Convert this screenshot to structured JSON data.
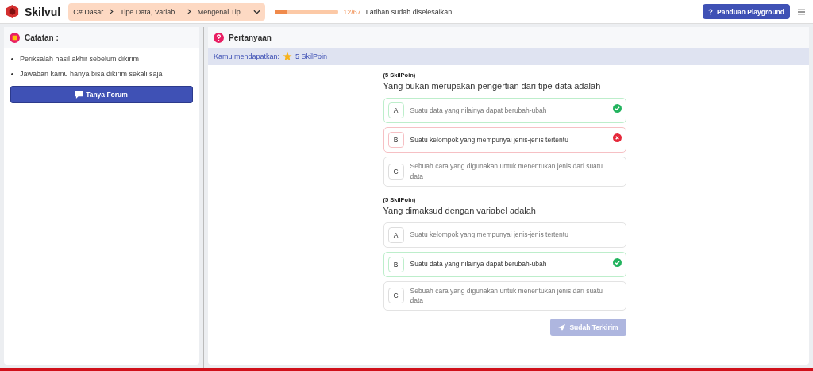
{
  "brand": "Skilvul",
  "breadcrumb": [
    "C# Dasar",
    "Tipe Data, Variab...",
    "Mengenal Tip..."
  ],
  "progress": {
    "level": 0.18,
    "count": "12/67",
    "label": "Latihan sudah diselesaikan"
  },
  "help_button": "Panduan Playground",
  "notes": {
    "title": "Catatan :",
    "items": [
      "Periksalah hasil akhir sebelum dikirim",
      "Jawaban kamu hanya bisa dikirim sekali saja"
    ],
    "button": "Tanya Forum"
  },
  "questions_panel": {
    "title": "Pertanyaan",
    "earned_label": "Kamu mendapatkan:",
    "earned_points": "5 SkilPoin",
    "questions": [
      {
        "points": "(5 SkilPoin)",
        "text": "Yang bukan merupakan pengertian dari tipe data adalah",
        "options": [
          {
            "letter": "A",
            "text": "Suatu data yang nilainya dapat berubah-ubah",
            "selected": false,
            "kind": "correct"
          },
          {
            "letter": "B",
            "text": "Suatu kelompok yang mempunyai jenis-jenis tertentu",
            "selected": true,
            "kind": "wrong"
          },
          {
            "letter": "C",
            "text": "Sebuah cara yang digunakan untuk menentukan jenis dari suatu data",
            "selected": false,
            "kind": "plain"
          }
        ]
      },
      {
        "points": "(5 SkilPoin)",
        "text": "Yang dimaksud dengan variabel adalah",
        "options": [
          {
            "letter": "A",
            "text": "Suatu kelompok yang mempunyai jenis-jenis tertentu",
            "selected": false,
            "kind": "plain"
          },
          {
            "letter": "B",
            "text": "Suatu data yang nilainya dapat berubah-ubah",
            "selected": true,
            "kind": "correct"
          },
          {
            "letter": "C",
            "text": "Sebuah cara yang digunakan untuk menentukan jenis dari suatu data",
            "selected": false,
            "kind": "plain"
          }
        ]
      }
    ],
    "submit": {
      "label": "Sudah Terkirim",
      "disabled": true
    }
  }
}
